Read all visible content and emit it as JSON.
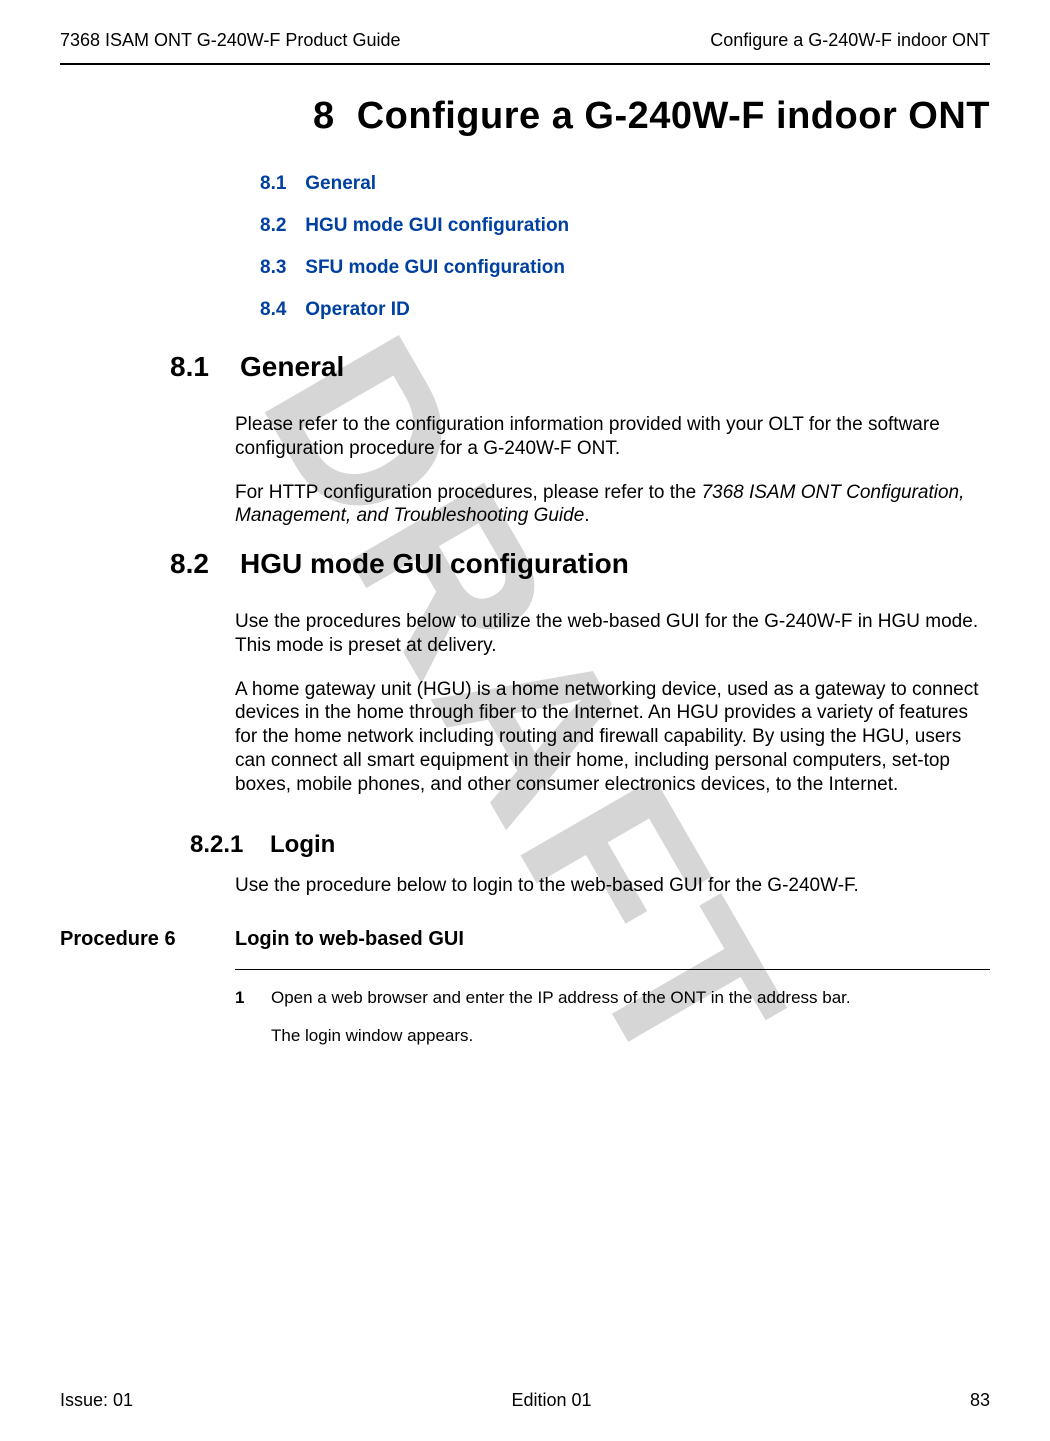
{
  "header": {
    "left": "7368 ISAM ONT G-240W-F Product Guide",
    "right": "Configure a G-240W-F indoor ONT"
  },
  "chapter": {
    "number": "8",
    "title": "Configure a G-240W-F indoor ONT"
  },
  "toc": [
    {
      "num": "8.1",
      "label": "General"
    },
    {
      "num": "8.2",
      "label": "HGU mode GUI configuration"
    },
    {
      "num": "8.3",
      "label": "SFU mode GUI configuration"
    },
    {
      "num": "8.4",
      "label": "Operator ID"
    }
  ],
  "sections": {
    "s81": {
      "num": "8.1",
      "title": "General",
      "para1": "Please refer to the configuration information provided with your OLT for the software configuration procedure for a G-240W-F ONT.",
      "para2a": "For HTTP configuration procedures, please refer to the ",
      "para2i": "7368 ISAM ONT Configuration, Management, and Troubleshooting Guide",
      "para2b": "."
    },
    "s82": {
      "num": "8.2",
      "title": "HGU mode GUI configuration",
      "para1": "Use the procedures below to utilize the web-based GUI for the G-240W-F in HGU mode. This mode is preset at delivery.",
      "para2": "A home gateway unit (HGU) is a home networking device, used as a gateway to connect devices in the home through fiber to the Internet. An HGU provides a variety of features for the home network including routing and firewall capability. By using the HGU, users can connect all smart equipment in their home, including personal computers, set-top boxes, mobile phones, and other consumer electronics devices, to the Internet."
    },
    "s821": {
      "num": "8.2.1",
      "title": "Login",
      "para1": "Use the procedure below to login to the web-based GUI for the G-240W-F."
    }
  },
  "procedure": {
    "label": "Procedure 6",
    "title": "Login to web-based GUI",
    "steps": [
      {
        "num": "1",
        "text": "Open a web browser and enter the IP address of the ONT in the address bar.",
        "sub": "The login window appears."
      }
    ]
  },
  "footer": {
    "left": "Issue: 01",
    "center": "Edition 01",
    "right": "83"
  },
  "watermark": "DRAFT"
}
